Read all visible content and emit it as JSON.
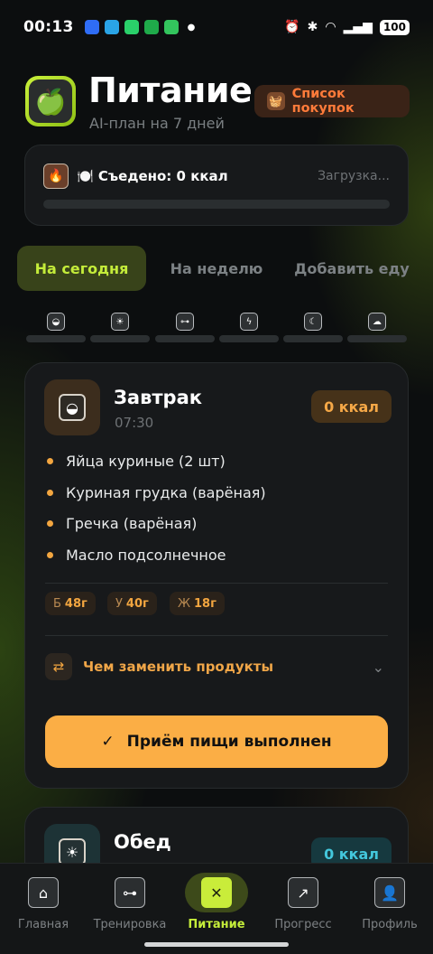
{
  "status_bar": {
    "time": "00:13",
    "battery": "100",
    "app_icon_colors": [
      "#2f6df6",
      "#2aa4e6",
      "#2ad06a",
      "#1faa4a",
      "#33c45d"
    ]
  },
  "header": {
    "title": "Питание",
    "subtitle": "AI-план на 7 дней",
    "shopping_list_label": "Список покупок"
  },
  "eaten": {
    "label": "🍽️ Съедено: 0 ккал",
    "loading": "Загрузка..."
  },
  "tabs": [
    {
      "label": "На сегодня",
      "active": true
    },
    {
      "label": "На неделю",
      "active": false
    },
    {
      "label": "Добавить еду",
      "active": false
    }
  ],
  "meal_strip_icons": [
    "sunrise-icon",
    "sun-icon",
    "dumbbell-icon",
    "lightning-icon",
    "moon-icon",
    "cloud-icon"
  ],
  "breakfast": {
    "name": "Завтрак",
    "time": "07:30",
    "kcal": "0 ккал",
    "items": [
      "Яйца куриные (2 шт)",
      "Куриная грудка (варёная)",
      "Гречка (варёная)",
      "Масло подсолнечное"
    ],
    "macros": [
      {
        "key": "Б",
        "value": "48г"
      },
      {
        "key": "У",
        "value": "40г"
      },
      {
        "key": "Ж",
        "value": "18г"
      }
    ],
    "replace_label": "Чем заменить продукты",
    "done_label": "Приём пищи выполнен"
  },
  "lunch": {
    "name": "Обед",
    "kcal": "0 ккал"
  },
  "nav": [
    {
      "label": "Главная",
      "active": false
    },
    {
      "label": "Тренировка",
      "active": false
    },
    {
      "label": "Питание",
      "active": true
    },
    {
      "label": "Прогресс",
      "active": false
    },
    {
      "label": "Профиль",
      "active": false
    }
  ]
}
